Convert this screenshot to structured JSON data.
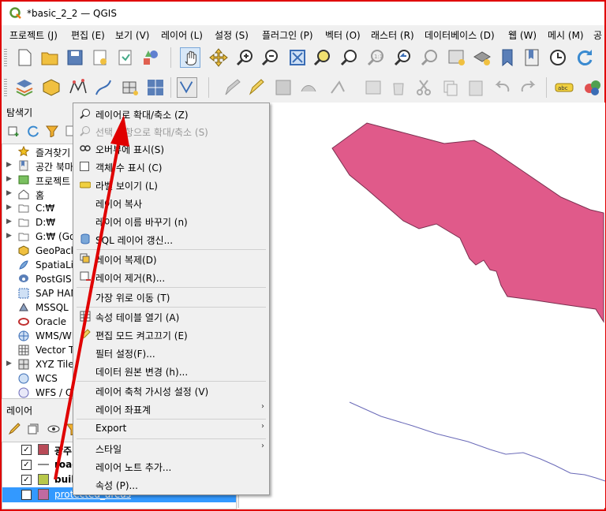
{
  "window": {
    "title": "*basic_2_2 — QGIS"
  },
  "menubar": [
    "프로젝트 (J)",
    "편집 (E)",
    "보기 (V)",
    "레이어 (L)",
    "설정 (S)",
    "플러그인 (P)",
    "벡터 (O)",
    "래스터 (R)",
    "데이터베이스 (D)",
    "웹 (W)",
    "메시 (M)",
    "공"
  ],
  "browser": {
    "title": "탐색기",
    "items": [
      {
        "label": "즐겨찾기",
        "icon": "star-icon"
      },
      {
        "label": "공간 북마",
        "icon": "bookmark-icon"
      },
      {
        "label": "프로젝트",
        "icon": "project-icon"
      },
      {
        "label": "홈",
        "icon": "home-icon"
      },
      {
        "label": "C:₩",
        "icon": "folder-icon"
      },
      {
        "label": "D:₩",
        "icon": "folder-icon"
      },
      {
        "label": "G:₩ (Goo",
        "icon": "folder-icon"
      },
      {
        "label": "GeoPacka",
        "icon": "geopackage-icon"
      },
      {
        "label": "SpatiaLite",
        "icon": "spatialite-icon"
      },
      {
        "label": "PostGIS",
        "icon": "postgis-icon"
      },
      {
        "label": "SAP HAN",
        "icon": "sap-hana-icon"
      },
      {
        "label": "MSSQL",
        "icon": "mssql-icon"
      },
      {
        "label": "Oracle",
        "icon": "oracle-icon"
      },
      {
        "label": "WMS/WM",
        "icon": "wms-icon"
      },
      {
        "label": "Vector Til",
        "icon": "vector-tile-icon"
      },
      {
        "label": "XYZ Tiles",
        "icon": "xyz-tiles-icon"
      },
      {
        "label": "WCS",
        "icon": "wcs-icon"
      },
      {
        "label": "WFS / O",
        "icon": "wfs-icon"
      }
    ]
  },
  "layers": {
    "title": "레이어",
    "items": [
      {
        "name": "광주",
        "color": "#b84a57",
        "checked": "✓"
      },
      {
        "name": "road",
        "color": "#666666",
        "checked": "✓"
      },
      {
        "name": "buil",
        "color": "#b8c84a",
        "checked": "✓"
      },
      {
        "name": "protected_areas",
        "color": "#c06aa0",
        "checked": "✓"
      }
    ]
  },
  "context_menu": {
    "items": [
      {
        "label": "레이어로 확대/축소 (Z)",
        "icon": "zoom-layer-icon",
        "disabled": false
      },
      {
        "label": "선택 사항으로 확대/축소 (S)",
        "icon": "zoom-selection-icon",
        "disabled": true
      },
      {
        "label": "오버뷰에 표시(S)",
        "icon": "overview-icon",
        "disabled": false
      },
      {
        "label": "객체 수 표시 (C)",
        "icon": "checkbox-icon",
        "disabled": false
      },
      {
        "label": "라벨 보이기 (L)",
        "icon": "label-icon",
        "disabled": false
      },
      {
        "label": "레이어 복사",
        "icon": "",
        "disabled": false
      },
      {
        "label": "레이어 이름 바꾸기 (n)",
        "icon": "",
        "disabled": false
      },
      {
        "label": "SQL 레이어 갱신...",
        "icon": "database-icon",
        "disabled": false
      },
      {
        "label": "레이어 복제(D)",
        "icon": "duplicate-icon",
        "disabled": false
      },
      {
        "label": "레이어 제거(R)...",
        "icon": "remove-layer-icon",
        "disabled": false
      },
      {
        "label": "가장 위로 이동 (T)",
        "icon": "",
        "disabled": false
      },
      {
        "label": "속성 테이블 열기 (A)",
        "icon": "table-icon",
        "disabled": false
      },
      {
        "label": "편집 모드 켜고끄기 (E)",
        "icon": "pencil-icon",
        "disabled": false
      },
      {
        "label": "필터 설정(F)...",
        "icon": "",
        "disabled": false
      },
      {
        "label": "데이터 원본 변경 (h)...",
        "icon": "",
        "disabled": false
      },
      {
        "label": "레이어 축척 가시성 설정 (V)",
        "icon": "",
        "disabled": false
      },
      {
        "label": "레이어 좌표계",
        "icon": "",
        "disabled": false,
        "submenu": "›"
      },
      {
        "label": "Export",
        "icon": "",
        "disabled": false,
        "submenu": "›"
      },
      {
        "label": "스타일",
        "icon": "",
        "disabled": false,
        "submenu": "›"
      },
      {
        "label": "레이어 노트 추가...",
        "icon": "",
        "disabled": false
      },
      {
        "label": "속성 (P)...",
        "icon": "",
        "disabled": false
      }
    ]
  },
  "map": {
    "polygon_color": "#e05a8a",
    "road_color": "#6a6ab8"
  },
  "annotation": {
    "arrow_color": "#e00000"
  }
}
